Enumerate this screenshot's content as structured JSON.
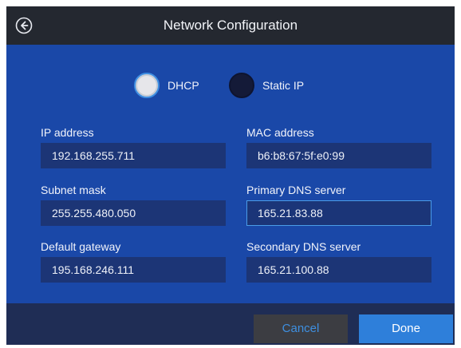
{
  "header": {
    "title": "Network Configuration",
    "back_icon": "arrow-left-circle-icon"
  },
  "mode": {
    "selected": "DHCP",
    "options": [
      {
        "label": "DHCP",
        "selected": true
      },
      {
        "label": "Static IP",
        "selected": false
      }
    ]
  },
  "fields": {
    "ip_address": {
      "label": "IP address",
      "value": "192.168.255.711"
    },
    "mac_address": {
      "label": "MAC address",
      "value": "b6:b8:67:5f:e0:99"
    },
    "subnet_mask": {
      "label": "Subnet mask",
      "value": "255.255.480.050"
    },
    "primary_dns": {
      "label": "Primary DNS server",
      "value": "165.21.83.88",
      "focused": true
    },
    "default_gateway": {
      "label": "Default gateway",
      "value": "195.168.246.111"
    },
    "secondary_dns": {
      "label": "Secondary DNS server",
      "value": "165.21.100.88"
    }
  },
  "footer": {
    "cancel_label": "Cancel",
    "done_label": "Done"
  },
  "colors": {
    "panel_background": "#1a48a8",
    "header_background": "#242830",
    "field_background": "#1c3576",
    "focus_border": "#4a9ce8",
    "done_button": "#2e7fda",
    "cancel_button": "#3c3d42"
  }
}
